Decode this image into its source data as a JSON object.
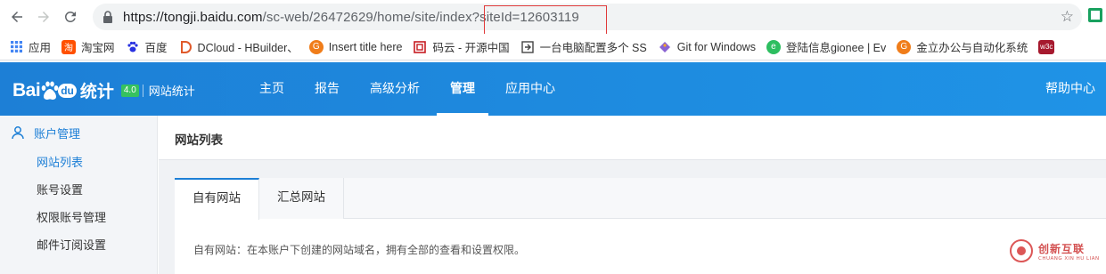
{
  "browser": {
    "url_host": "https://tongji.baidu.com",
    "url_path": "/sc-web/26472629/home/site/index?siteId=12603119",
    "bookmarks": [
      {
        "label": "应用",
        "icon": "apps-grid-icon",
        "color": "#4285f4"
      },
      {
        "label": "淘宝网",
        "icon": "taobao-icon",
        "color": "#ff5000"
      },
      {
        "label": "百度",
        "icon": "baidu-paw-icon",
        "color": "#2932e1"
      },
      {
        "label": "DCloud - HBuilder、",
        "icon": "dcloud-icon",
        "color": "#e05a2b"
      },
      {
        "label": "Insert title here",
        "icon": "orange-circle-icon",
        "color": "#f07d1a"
      },
      {
        "label": "码云 - 开源中国",
        "icon": "gitee-icon",
        "color": "#c71d23"
      },
      {
        "label": "一台电脑配置多个 SS",
        "icon": "page-icon",
        "color": "#444444"
      },
      {
        "label": "Git for Windows",
        "icon": "git-diamond-icon",
        "color": "#8a63d2"
      },
      {
        "label": "登陆信息gionee | Ev",
        "icon": "evernote-icon",
        "color": "#2dbe60"
      },
      {
        "label": "金立办公与自动化系统",
        "icon": "orange-circle-icon",
        "color": "#f07d1a"
      },
      {
        "label": "w3c",
        "icon": "w3c-icon",
        "color": "#a6192e"
      }
    ]
  },
  "header": {
    "logo_text": "Bai",
    "logo_du": "du",
    "logo_tongji": "统计",
    "version": "4.0",
    "site_title": "网站统计",
    "nav": [
      {
        "label": "主页",
        "active": false
      },
      {
        "label": "报告",
        "active": false
      },
      {
        "label": "高级分析",
        "active": false
      },
      {
        "label": "管理",
        "active": true
      },
      {
        "label": "应用中心",
        "active": false
      }
    ],
    "help": "帮助中心",
    "brand_color": "#1d7fd6"
  },
  "sidebar": {
    "section": "账户管理",
    "items": [
      {
        "label": "网站列表",
        "active": true
      },
      {
        "label": "账号设置",
        "active": false
      },
      {
        "label": "权限账号管理",
        "active": false
      },
      {
        "label": "邮件订阅设置",
        "active": false
      }
    ]
  },
  "main": {
    "page_title": "网站列表",
    "tabs": [
      {
        "label": "自有网站",
        "active": true
      },
      {
        "label": "汇总网站",
        "active": false
      }
    ],
    "description": "自有网站：在本账户下创建的网站域名，拥有全部的查看和设置权限。"
  },
  "watermark": {
    "cn": "创新互联",
    "en": "CHUANG XIN HU LIAN"
  }
}
